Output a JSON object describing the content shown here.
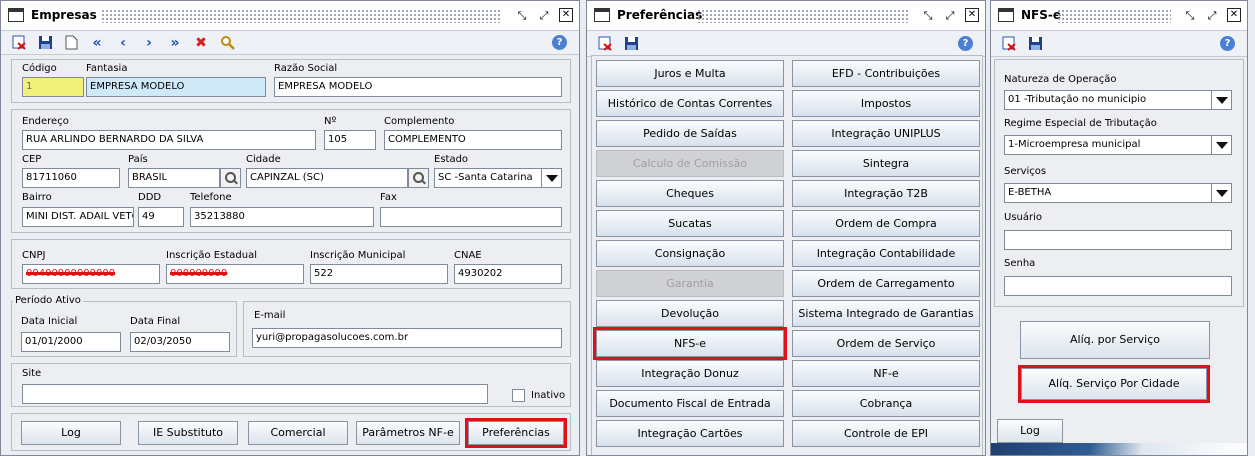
{
  "empresas": {
    "title": "Empresas",
    "help_label": "?",
    "codigo": {
      "label": "Código",
      "value": "1"
    },
    "fantasia": {
      "label": "Fantasia",
      "value": "EMPRESA MODELO"
    },
    "razao": {
      "label": "Razão Social",
      "value": "EMPRESA MODELO"
    },
    "endereco": {
      "label": "Endereço",
      "value": "RUA ARLINDO BERNARDO DA SILVA"
    },
    "numero": {
      "label": "Nº",
      "value": "105"
    },
    "complemento": {
      "label": "Complemento",
      "value": "COMPLEMENTO"
    },
    "cep": {
      "label": "CEP",
      "value": "81711060"
    },
    "pais": {
      "label": "País",
      "value": "BRASIL"
    },
    "cidade": {
      "label": "Cidade",
      "value": "CAPINZAL (SC)"
    },
    "estado": {
      "label": "Estado",
      "value": "SC -Santa Catarina"
    },
    "bairro": {
      "label": "Bairro",
      "value": "MINI DIST. ADAIL VETO"
    },
    "ddd": {
      "label": "DDD",
      "value": "49"
    },
    "telefone": {
      "label": "Telefone",
      "value": "35213880"
    },
    "fax": {
      "label": "Fax",
      "value": ""
    },
    "cnpj": {
      "label": "CNPJ",
      "value": "00400000000000"
    },
    "ie": {
      "label": "Inscrição Estadual",
      "value": "000000000"
    },
    "im": {
      "label": "Inscrição Municipal",
      "value": "522"
    },
    "cnae": {
      "label": "CNAE",
      "value": "4930202"
    },
    "periodo": {
      "legend": "Período Ativo",
      "inicial_label": "Data Inicial",
      "inicial": "01/01/2000",
      "final_label": "Data Final",
      "final": "02/03/2050"
    },
    "email": {
      "label": "E-mail",
      "value": "yuri@propagasolucoes.com.br"
    },
    "site": {
      "label": "Site",
      "value": ""
    },
    "inativo": {
      "label": "Inativo",
      "checked": false
    },
    "buttons": {
      "log": "Log",
      "ie_sub": "IE Substituto",
      "comercial": "Comercial",
      "parametros": "Parâmetros NF-e",
      "preferencias": "Preferências"
    }
  },
  "preferencias": {
    "title": "Preferências",
    "help_label": "?",
    "left": [
      {
        "label": "Juros e Multa",
        "enabled": true
      },
      {
        "label": "Histórico de Contas Correntes",
        "enabled": true
      },
      {
        "label": "Pedido de Saídas",
        "enabled": true
      },
      {
        "label": "Calculo de Comissão",
        "enabled": false
      },
      {
        "label": "Cheques",
        "enabled": true
      },
      {
        "label": "Sucatas",
        "enabled": true
      },
      {
        "label": "Consignação",
        "enabled": true
      },
      {
        "label": "Garantia",
        "enabled": false
      },
      {
        "label": "Devolução",
        "enabled": true
      },
      {
        "label": "NFS-e",
        "enabled": true,
        "highlighted": true
      },
      {
        "label": "Integração Donuz",
        "enabled": true
      },
      {
        "label": "Documento Fiscal de Entrada",
        "enabled": true
      },
      {
        "label": "Integração Cartões",
        "enabled": true
      }
    ],
    "right": [
      {
        "label": "EFD - Contribuições"
      },
      {
        "label": "Impostos"
      },
      {
        "label": "Integração UNIPLUS"
      },
      {
        "label": "Sintegra"
      },
      {
        "label": "Integração T2B"
      },
      {
        "label": "Ordem de Compra"
      },
      {
        "label": "Integração Contabilidade"
      },
      {
        "label": "Ordem de Carregamento"
      },
      {
        "label": "Sistema Integrado de Garantias"
      },
      {
        "label": "Ordem de Serviço"
      },
      {
        "label": "NF-e"
      },
      {
        "label": "Cobrança"
      },
      {
        "label": "Controle de EPI"
      }
    ]
  },
  "nfse": {
    "title": "NFS-e",
    "help_label": "?",
    "natureza": {
      "label": "Natureza de  Operação",
      "value": "01 -Tributação no municipio"
    },
    "regime": {
      "label": "Regime Especial de Tributação",
      "value": "1-Microempresa municipal"
    },
    "servicos": {
      "label": "Serviços",
      "value": "E-BETHA"
    },
    "usuario": {
      "label": "Usuário",
      "value": ""
    },
    "senha": {
      "label": "Senha",
      "value": ""
    },
    "buttons": {
      "aliq": "Alíq. por Serviço",
      "aliq_cidade": "Alíq. Serviço Por Cidade",
      "log": "Log"
    }
  },
  "colors": {
    "highlight": "#e0101a",
    "link_blue": "#1c4fb0"
  }
}
